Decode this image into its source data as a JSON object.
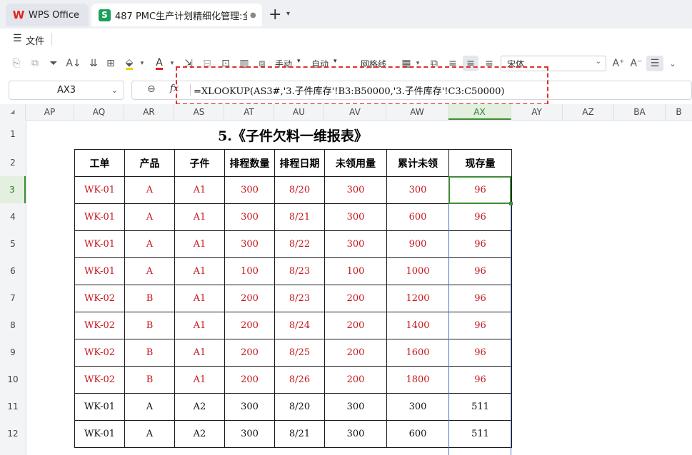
{
  "tabs": {
    "home_label": "WPS Office",
    "doc_icon_letter": "S",
    "doc_title": "487 PMC生产计划精细化管理:全",
    "new_tab_icon": "plus-icon",
    "tabs_menu_icon": "chevron-down-icon"
  },
  "menu": {
    "file_label": "文件"
  },
  "toolbar": {
    "wrap_manual_label": "手动",
    "wrap_auto_label": "自动",
    "gridlines_label": "网格线",
    "font_name": "宋体"
  },
  "formula_bar": {
    "name_box": "AX3",
    "fx_label": "fx",
    "formula": "=XLOOKUP(AS3#,'3.子件库存'!B3:B50000,'3.子件库存'!C3:C50000)"
  },
  "columns": [
    "AP",
    "AQ",
    "AR",
    "AS",
    "AT",
    "AU",
    "AV",
    "AW",
    "AX",
    "AY",
    "AZ",
    "BA",
    "B"
  ],
  "selected_column": "AX",
  "rows": [
    "1",
    "2",
    "3",
    "4",
    "5",
    "6",
    "7",
    "8",
    "9",
    "10",
    "11",
    "12"
  ],
  "selected_row": "3",
  "sheet": {
    "title": "5.《子件欠料一维报表》",
    "headers": [
      "工单",
      "产品",
      "子件",
      "排程数量",
      "排程日期",
      "未领用量",
      "累计未领",
      "现存量"
    ],
    "data": [
      [
        "WK-01",
        "A",
        "A1",
        "300",
        "8/20",
        "300",
        "300",
        "96"
      ],
      [
        "WK-01",
        "A",
        "A1",
        "300",
        "8/21",
        "300",
        "600",
        "96"
      ],
      [
        "WK-01",
        "A",
        "A1",
        "300",
        "8/22",
        "300",
        "900",
        "96"
      ],
      [
        "WK-01",
        "A",
        "A1",
        "100",
        "8/23",
        "100",
        "1000",
        "96"
      ],
      [
        "WK-02",
        "B",
        "A1",
        "200",
        "8/23",
        "200",
        "1200",
        "96"
      ],
      [
        "WK-02",
        "B",
        "A1",
        "200",
        "8/24",
        "200",
        "1400",
        "96"
      ],
      [
        "WK-02",
        "B",
        "A1",
        "200",
        "8/25",
        "200",
        "1600",
        "96"
      ],
      [
        "WK-02",
        "B",
        "A1",
        "200",
        "8/26",
        "200",
        "1800",
        "96"
      ],
      [
        "WK-01",
        "A",
        "A2",
        "300",
        "8/20",
        "300",
        "300",
        "511"
      ],
      [
        "WK-01",
        "A",
        "A2",
        "300",
        "8/21",
        "300",
        "600",
        "511"
      ]
    ]
  },
  "colors": {
    "red_text": "#c4161c",
    "selection_green": "#3f8c37",
    "highlight_red": "#e0312b",
    "sheet_icon_green": "#1ba05a"
  }
}
